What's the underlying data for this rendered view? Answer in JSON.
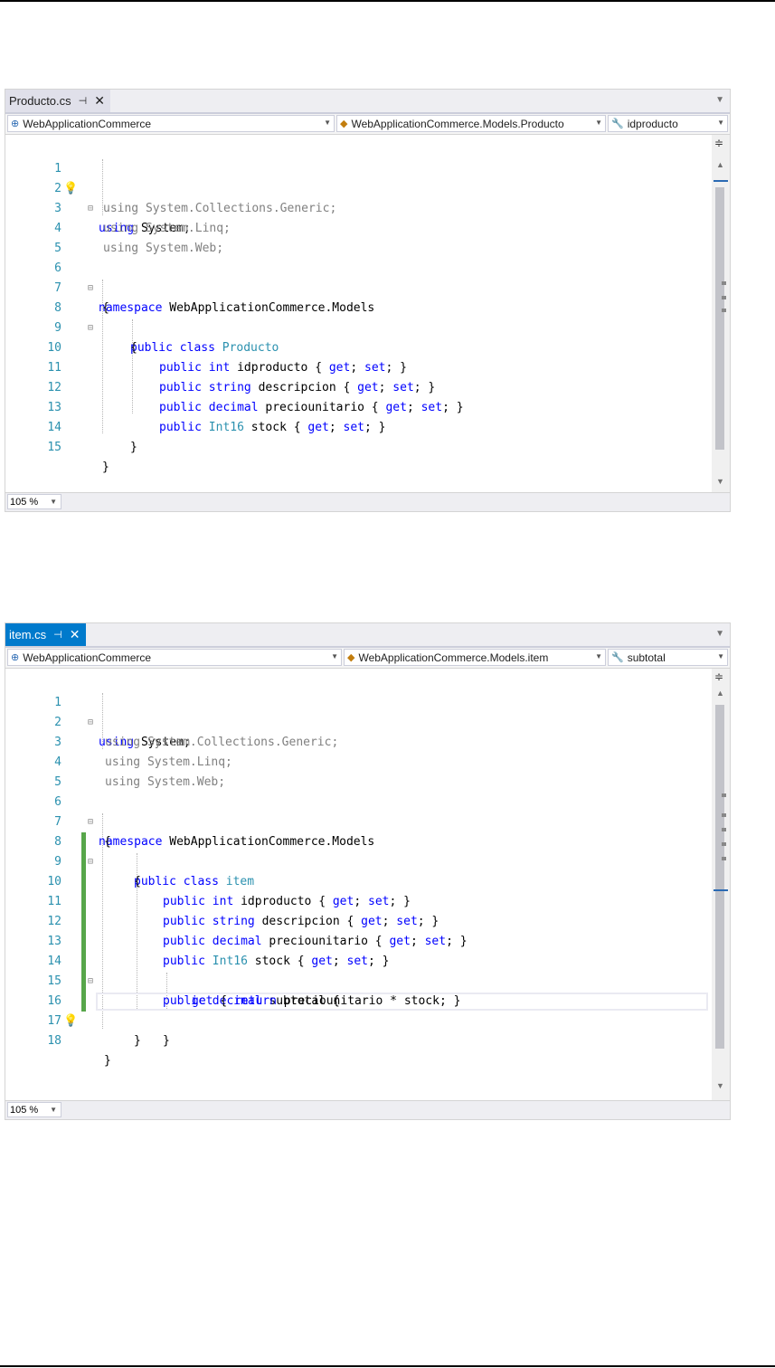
{
  "editors": [
    {
      "tab_label": "Producto.cs",
      "pin_icon": "pin-icon",
      "close_icon": "close-icon",
      "nav_project": "WebApplicationCommerce",
      "nav_class": "WebApplicationCommerce.Models.Producto",
      "nav_member": "idproducto",
      "zoom": "105 %",
      "lines": [
        {
          "n": "1",
          "t": "using System;"
        },
        {
          "n": "2",
          "t": "using System.Collections.Generic;"
        },
        {
          "n": "3",
          "t": "using System.Linq;"
        },
        {
          "n": "4",
          "t": "using System.Web;"
        },
        {
          "n": "5",
          "t": ""
        },
        {
          "n": "6",
          "t": "namespace WebApplicationCommerce.Models"
        },
        {
          "n": "7",
          "t": "{"
        },
        {
          "n": "8",
          "t": "public class Producto"
        },
        {
          "n": "9",
          "t": "{"
        },
        {
          "n": "10",
          "t": "public int idproducto { get; set; }"
        },
        {
          "n": "11",
          "t": "public string descripcion { get; set; }"
        },
        {
          "n": "12",
          "t": "public decimal preciounitario { get; set; }"
        },
        {
          "n": "13",
          "t": "public Int16 stock { get; set; }"
        },
        {
          "n": "14",
          "t": "}"
        },
        {
          "n": "15",
          "t": "}"
        }
      ]
    },
    {
      "tab_label": "item.cs",
      "pin_icon": "pin-icon",
      "close_icon": "close-icon",
      "nav_project": "WebApplicationCommerce",
      "nav_class": "WebApplicationCommerce.Models.item",
      "nav_member": "subtotal",
      "zoom": "105 %",
      "lines": [
        {
          "n": "1",
          "t": "using System;"
        },
        {
          "n": "2",
          "t": "using System.Collections.Generic;"
        },
        {
          "n": "3",
          "t": "using System.Linq;"
        },
        {
          "n": "4",
          "t": "using System.Web;"
        },
        {
          "n": "5",
          "t": ""
        },
        {
          "n": "6",
          "t": "namespace WebApplicationCommerce.Models"
        },
        {
          "n": "7",
          "t": "{"
        },
        {
          "n": "8",
          "t": "public class item"
        },
        {
          "n": "9",
          "t": "{"
        },
        {
          "n": "10",
          "t": "public int idproducto { get; set; }"
        },
        {
          "n": "11",
          "t": "public string descripcion { get; set; }"
        },
        {
          "n": "12",
          "t": "public decimal preciounitario { get; set; }"
        },
        {
          "n": "13",
          "t": "public Int16 stock { get; set; }"
        },
        {
          "n": "14",
          "t": "public decimal subtotal {"
        },
        {
          "n": "15",
          "t": "get { return preciounitario * stock; }"
        },
        {
          "n": "16",
          "t": "}"
        },
        {
          "n": "17",
          "t": "}"
        },
        {
          "n": "18",
          "t": "}"
        }
      ]
    }
  ]
}
